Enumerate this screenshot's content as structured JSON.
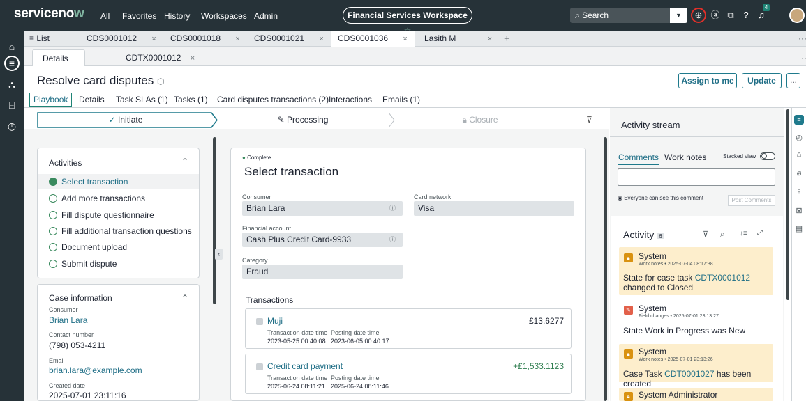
{
  "topbar": {
    "logo_prefix": "serviceno",
    "logo_accent": "w",
    "nav": [
      "All",
      "Favorites",
      "History",
      "Workspaces",
      "Admin"
    ],
    "workspace": "Financial Services Workspace",
    "search_placeholder": "Search",
    "bell_badge": "4"
  },
  "tabs": {
    "list_label": "List",
    "items": [
      "CDS0001012",
      "CDS0001018",
      "CDS0001021",
      "CDS0001036",
      "Lasith M"
    ],
    "active_index": 3,
    "close": "×",
    "add": "+"
  },
  "subtabs": {
    "details": "Details",
    "task": "CDTX0001012"
  },
  "record": {
    "title": "Resolve card disputes",
    "assign_label": "Assign to me",
    "update_label": "Update",
    "more_label": "..."
  },
  "record_tabs": [
    "Playbook",
    "Details",
    "Task SLAs (1)",
    "Tasks (1)",
    "Card disputes transactions (2)",
    "Interactions",
    "Emails (1)"
  ],
  "stages": {
    "initiate": "Initiate",
    "processing": "Processing",
    "closure": "Closure"
  },
  "activities": {
    "title": "Activities",
    "items": [
      "Select transaction",
      "Add more transactions",
      "Fill dispute questionnaire",
      "Fill additional transaction questions",
      "Document upload",
      "Submit dispute"
    ]
  },
  "case_info": {
    "title": "Case information",
    "consumer_label": "Consumer",
    "consumer": "Brian Lara",
    "contact_label": "Contact number",
    "contact": "(798) 053-4211",
    "email_label": "Email",
    "email": "brian.lara@example.com",
    "created_label": "Created date",
    "created": "2025-07-01 23:11:16"
  },
  "form": {
    "status": "Complete",
    "title": "Select transaction",
    "consumer_label": "Consumer",
    "consumer": "Brian Lara",
    "card_network_label": "Card network",
    "card_network": "Visa",
    "account_label": "Financial account",
    "account": "Cash Plus Credit Card-9933",
    "category_label": "Category",
    "category": "Fraud",
    "transactions_label": "Transactions",
    "tx_date_label": "Transaction date time",
    "post_date_label": "Posting date time",
    "transactions": [
      {
        "name": "Muji",
        "amount": "£13.6277",
        "tx_date": "2023-05-25 00:40:08",
        "post_date": "2023-06-05 00:40:17"
      },
      {
        "name": "Credit card payment",
        "amount": "+£1,533.1123",
        "tx_date": "2025-06-24 08:11:21",
        "post_date": "2025-06-24 08:11:46"
      }
    ]
  },
  "activity_stream": {
    "title": "Activity stream",
    "comments_tab": "Comments",
    "worknotes_tab": "Work notes",
    "stacked_view": "Stacked view",
    "visibility_note": "Everyone can see this comment",
    "post_button": "Post Comments",
    "activity_label": "Activity",
    "activity_count": "6",
    "entries": [
      {
        "author": "System",
        "meta": "Work notes • 2025-07-04 08:17:38",
        "text_pre": "State for case task ",
        "link": "CDTX0001012",
        "text_post": " changed to Closed"
      },
      {
        "author": "System",
        "meta": "Field changes • 2025-07-01 23:13:27",
        "text_pre": "State  Work in Progress was ",
        "strike": "New"
      },
      {
        "author": "System",
        "meta": "Work notes • 2025-07-01 23:13:26",
        "text_pre": "Case Task ",
        "link": "CDT0001027",
        "text_post": " has been created"
      },
      {
        "author": "System Administrator"
      }
    ]
  },
  "colors": {
    "topbar": "#263238",
    "accent": "#1f6e86",
    "worknote_bg": "#fdeecc",
    "complete_green": "#3a8a5e"
  }
}
